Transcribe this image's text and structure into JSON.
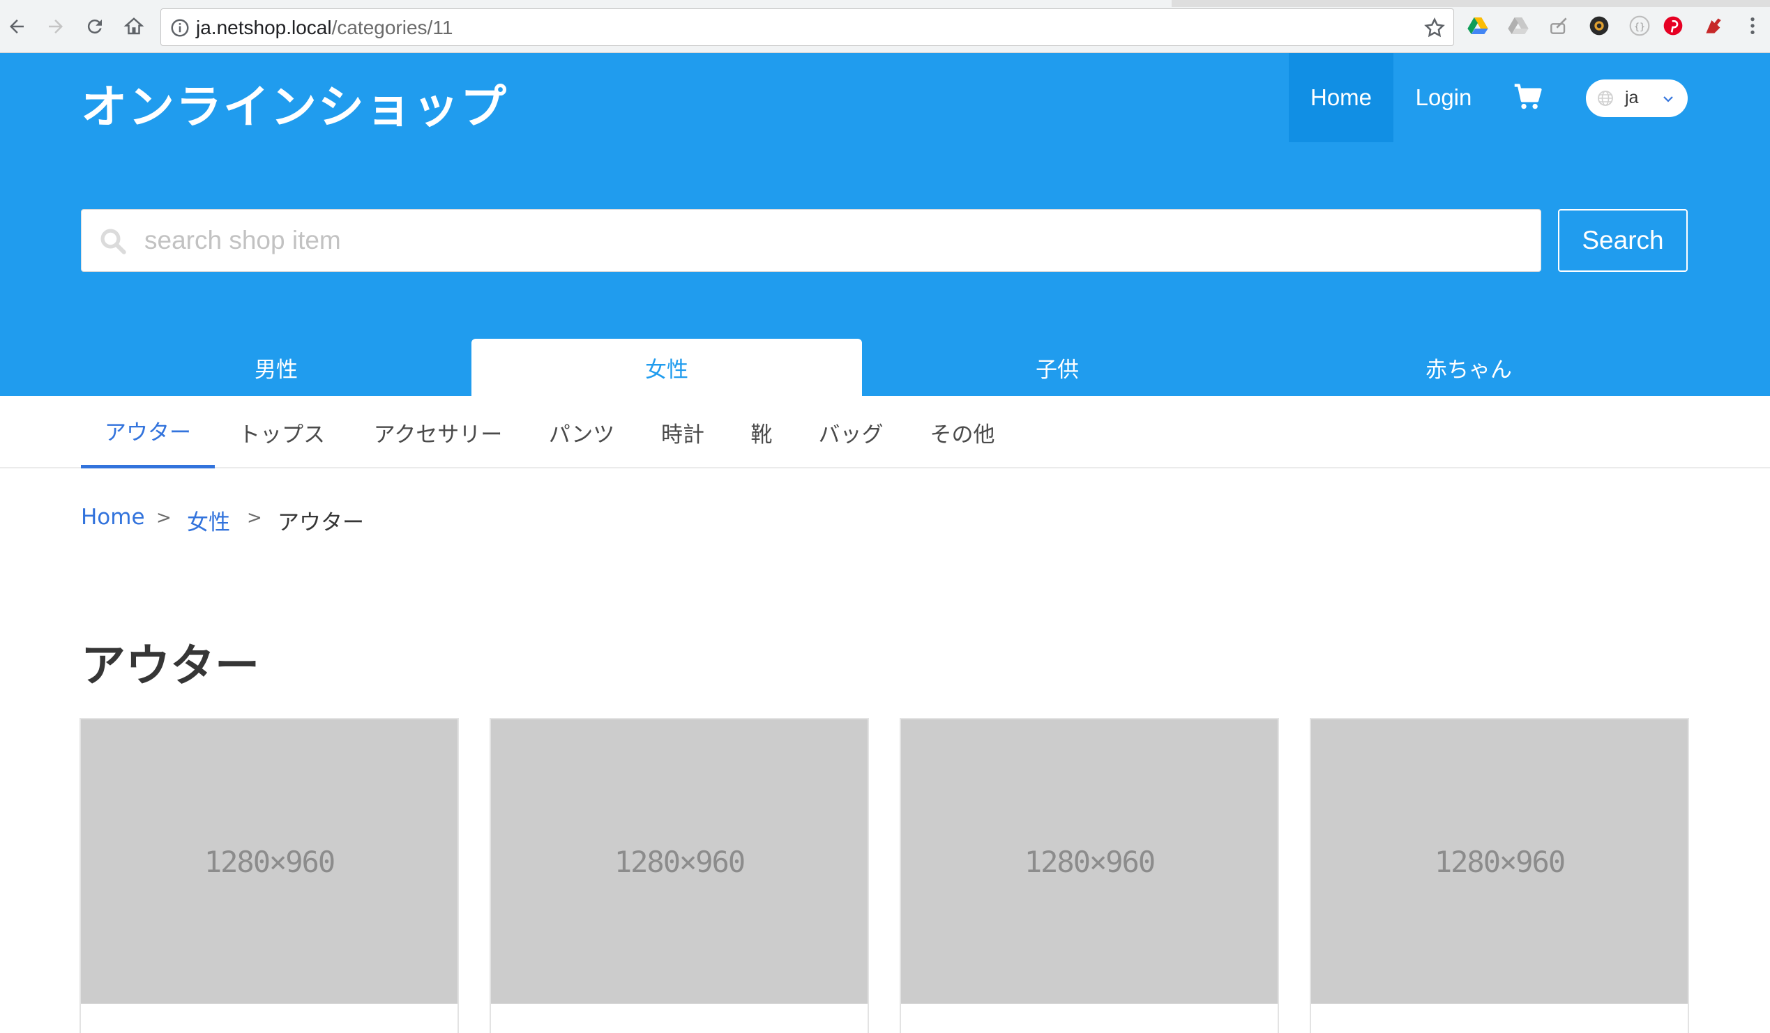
{
  "browser": {
    "url_host": "ja.netshop.local",
    "url_path": "/categories/11"
  },
  "header": {
    "brand": "オンラインショップ",
    "nav": {
      "home": "Home",
      "login": "Login"
    },
    "language": "ja",
    "accent_color": "#209cee"
  },
  "search": {
    "placeholder": "search shop item",
    "button": "Search"
  },
  "gender_tabs": [
    {
      "label": "男性",
      "active": false
    },
    {
      "label": "女性",
      "active": true
    },
    {
      "label": "子供",
      "active": false
    },
    {
      "label": "赤ちゃん",
      "active": false
    }
  ],
  "category_tabs": [
    {
      "label": "アウター",
      "active": true
    },
    {
      "label": "トップス",
      "active": false
    },
    {
      "label": "アクセサリー",
      "active": false
    },
    {
      "label": "パンツ",
      "active": false
    },
    {
      "label": "時計",
      "active": false
    },
    {
      "label": "靴",
      "active": false
    },
    {
      "label": "バッグ",
      "active": false
    },
    {
      "label": "その他",
      "active": false
    }
  ],
  "breadcrumb": {
    "items": [
      "Home",
      "女性",
      "アウター"
    ],
    "separator": ">"
  },
  "page_title": "アウター",
  "products": [
    {
      "image_label": "1280×960"
    },
    {
      "image_label": "1280×960"
    },
    {
      "image_label": "1280×960"
    },
    {
      "image_label": "1280×960"
    }
  ]
}
